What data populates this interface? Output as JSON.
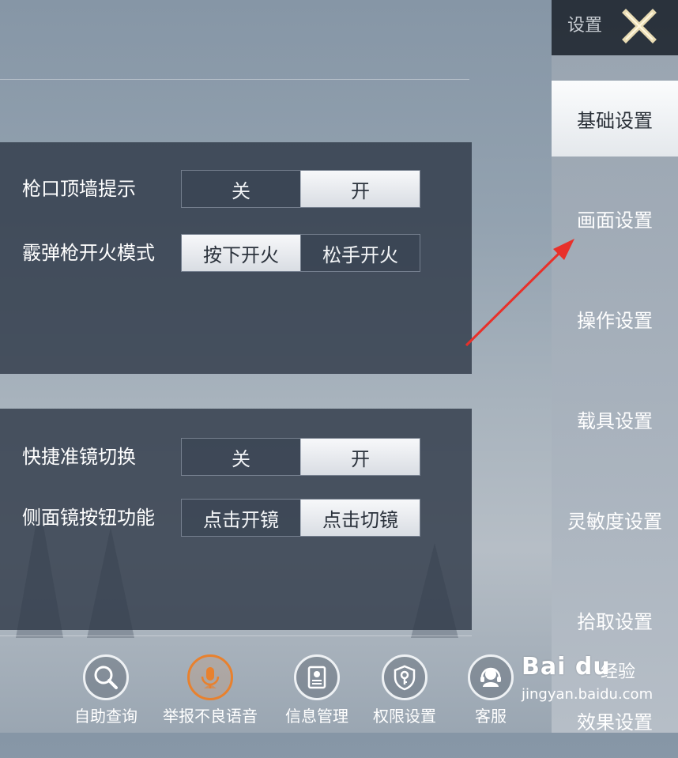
{
  "header": {
    "settings_title": "设置"
  },
  "sidebar": {
    "items": [
      {
        "label": "基础设置",
        "active": true
      },
      {
        "label": "画面设置",
        "active": false
      },
      {
        "label": "操作设置",
        "active": false
      },
      {
        "label": "载具设置",
        "active": false
      },
      {
        "label": "灵敏度设置",
        "active": false
      },
      {
        "label": "拾取设置",
        "active": false
      },
      {
        "label": "效果设置",
        "active": false
      }
    ]
  },
  "settings": [
    {
      "label": "枪口顶墙提示",
      "options": [
        "关",
        "开"
      ],
      "selected": "开"
    },
    {
      "label": "霰弹枪开火模式",
      "options": [
        "按下开火",
        "松手开火"
      ],
      "selected": "按下开火"
    },
    {
      "label": "快捷准镜切换",
      "options": [
        "关",
        "开"
      ],
      "selected": "开"
    },
    {
      "label": "侧面镜按钮功能",
      "options": [
        "点击开镜",
        "点击切镜"
      ],
      "selected": "点击切镜"
    }
  ],
  "bottom_bar": [
    {
      "label": "自助查询",
      "icon": "search-icon"
    },
    {
      "label": "举报不良语音",
      "icon": "microphone-icon",
      "color": "#e8812e"
    },
    {
      "label": "信息管理",
      "icon": "id-card-icon"
    },
    {
      "label": "权限设置",
      "icon": "shield-key-icon"
    },
    {
      "label": "客服",
      "icon": "headset-icon"
    }
  ],
  "watermark": {
    "logo": "Bai du",
    "text": "经验",
    "url": "jingyan.baidu.com"
  },
  "colors": {
    "annotation_arrow": "#e8302a",
    "accent_orange": "#e8812e"
  }
}
